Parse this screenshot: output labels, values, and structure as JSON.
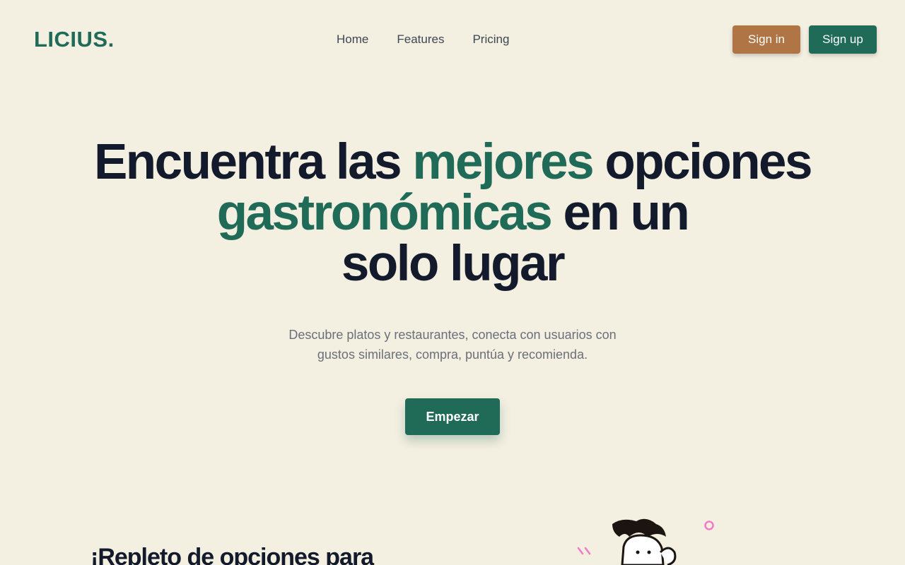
{
  "header": {
    "logo": "LICIUS.",
    "nav": [
      {
        "label": "Home"
      },
      {
        "label": "Features"
      },
      {
        "label": "Pricing"
      }
    ],
    "sign_in_label": "Sign in",
    "sign_up_label": "Sign up"
  },
  "hero": {
    "title_part1": "Encuentra las ",
    "title_accent1": "mejores",
    "title_part2": " opciones",
    "title_accent2": "gastronómicas",
    "title_part3": " en un",
    "title_part4": "solo lugar",
    "subtitle_line1": "Descubre platos y restaurantes, conecta con usuarios con",
    "subtitle_line2": "gustos similares, compra, puntúa y recomienda.",
    "cta_label": "Empezar"
  },
  "section": {
    "heading": "¡Repleto de opciones para"
  },
  "colors": {
    "background": "#f3efe1",
    "accent": "#1f6b58",
    "sign_in": "#b07545",
    "text_dark": "#121a2c",
    "text_muted": "#6b6f79"
  }
}
